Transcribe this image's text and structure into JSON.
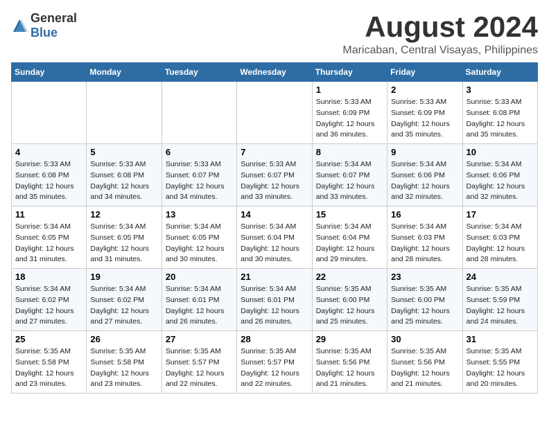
{
  "header": {
    "logo": {
      "general": "General",
      "blue": "Blue"
    },
    "month_year": "August 2024",
    "location": "Maricaban, Central Visayas, Philippines"
  },
  "calendar": {
    "days_of_week": [
      "Sunday",
      "Monday",
      "Tuesday",
      "Wednesday",
      "Thursday",
      "Friday",
      "Saturday"
    ],
    "weeks": [
      [
        {
          "day": "",
          "info": ""
        },
        {
          "day": "",
          "info": ""
        },
        {
          "day": "",
          "info": ""
        },
        {
          "day": "",
          "info": ""
        },
        {
          "day": "1",
          "sunrise": "5:33 AM",
          "sunset": "6:09 PM",
          "daylight": "12 hours and 36 minutes."
        },
        {
          "day": "2",
          "sunrise": "5:33 AM",
          "sunset": "6:09 PM",
          "daylight": "12 hours and 35 minutes."
        },
        {
          "day": "3",
          "sunrise": "5:33 AM",
          "sunset": "6:08 PM",
          "daylight": "12 hours and 35 minutes."
        }
      ],
      [
        {
          "day": "4",
          "sunrise": "5:33 AM",
          "sunset": "6:08 PM",
          "daylight": "12 hours and 35 minutes."
        },
        {
          "day": "5",
          "sunrise": "5:33 AM",
          "sunset": "6:08 PM",
          "daylight": "12 hours and 34 minutes."
        },
        {
          "day": "6",
          "sunrise": "5:33 AM",
          "sunset": "6:07 PM",
          "daylight": "12 hours and 34 minutes."
        },
        {
          "day": "7",
          "sunrise": "5:33 AM",
          "sunset": "6:07 PM",
          "daylight": "12 hours and 33 minutes."
        },
        {
          "day": "8",
          "sunrise": "5:34 AM",
          "sunset": "6:07 PM",
          "daylight": "12 hours and 33 minutes."
        },
        {
          "day": "9",
          "sunrise": "5:34 AM",
          "sunset": "6:06 PM",
          "daylight": "12 hours and 32 minutes."
        },
        {
          "day": "10",
          "sunrise": "5:34 AM",
          "sunset": "6:06 PM",
          "daylight": "12 hours and 32 minutes."
        }
      ],
      [
        {
          "day": "11",
          "sunrise": "5:34 AM",
          "sunset": "6:05 PM",
          "daylight": "12 hours and 31 minutes."
        },
        {
          "day": "12",
          "sunrise": "5:34 AM",
          "sunset": "6:05 PM",
          "daylight": "12 hours and 31 minutes."
        },
        {
          "day": "13",
          "sunrise": "5:34 AM",
          "sunset": "6:05 PM",
          "daylight": "12 hours and 30 minutes."
        },
        {
          "day": "14",
          "sunrise": "5:34 AM",
          "sunset": "6:04 PM",
          "daylight": "12 hours and 30 minutes."
        },
        {
          "day": "15",
          "sunrise": "5:34 AM",
          "sunset": "6:04 PM",
          "daylight": "12 hours and 29 minutes."
        },
        {
          "day": "16",
          "sunrise": "5:34 AM",
          "sunset": "6:03 PM",
          "daylight": "12 hours and 28 minutes."
        },
        {
          "day": "17",
          "sunrise": "5:34 AM",
          "sunset": "6:03 PM",
          "daylight": "12 hours and 28 minutes."
        }
      ],
      [
        {
          "day": "18",
          "sunrise": "5:34 AM",
          "sunset": "6:02 PM",
          "daylight": "12 hours and 27 minutes."
        },
        {
          "day": "19",
          "sunrise": "5:34 AM",
          "sunset": "6:02 PM",
          "daylight": "12 hours and 27 minutes."
        },
        {
          "day": "20",
          "sunrise": "5:34 AM",
          "sunset": "6:01 PM",
          "daylight": "12 hours and 26 minutes."
        },
        {
          "day": "21",
          "sunrise": "5:34 AM",
          "sunset": "6:01 PM",
          "daylight": "12 hours and 26 minutes."
        },
        {
          "day": "22",
          "sunrise": "5:35 AM",
          "sunset": "6:00 PM",
          "daylight": "12 hours and 25 minutes."
        },
        {
          "day": "23",
          "sunrise": "5:35 AM",
          "sunset": "6:00 PM",
          "daylight": "12 hours and 25 minutes."
        },
        {
          "day": "24",
          "sunrise": "5:35 AM",
          "sunset": "5:59 PM",
          "daylight": "12 hours and 24 minutes."
        }
      ],
      [
        {
          "day": "25",
          "sunrise": "5:35 AM",
          "sunset": "5:58 PM",
          "daylight": "12 hours and 23 minutes."
        },
        {
          "day": "26",
          "sunrise": "5:35 AM",
          "sunset": "5:58 PM",
          "daylight": "12 hours and 23 minutes."
        },
        {
          "day": "27",
          "sunrise": "5:35 AM",
          "sunset": "5:57 PM",
          "daylight": "12 hours and 22 minutes."
        },
        {
          "day": "28",
          "sunrise": "5:35 AM",
          "sunset": "5:57 PM",
          "daylight": "12 hours and 22 minutes."
        },
        {
          "day": "29",
          "sunrise": "5:35 AM",
          "sunset": "5:56 PM",
          "daylight": "12 hours and 21 minutes."
        },
        {
          "day": "30",
          "sunrise": "5:35 AM",
          "sunset": "5:56 PM",
          "daylight": "12 hours and 21 minutes."
        },
        {
          "day": "31",
          "sunrise": "5:35 AM",
          "sunset": "5:55 PM",
          "daylight": "12 hours and 20 minutes."
        }
      ]
    ]
  }
}
